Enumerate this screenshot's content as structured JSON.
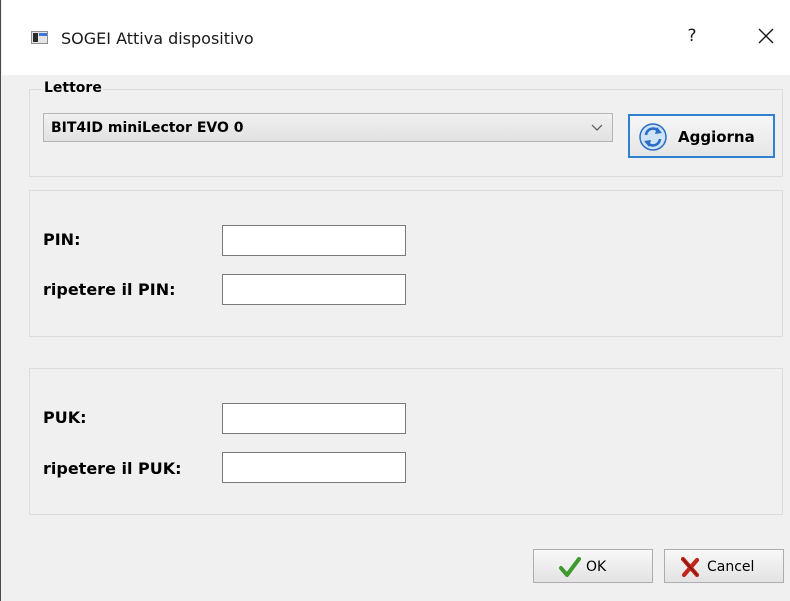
{
  "window": {
    "title": "SOGEI Attiva dispositivo",
    "help_label": "?",
    "app_icon": "window-app-icon",
    "close_icon": "close-icon"
  },
  "reader_group": {
    "legend": "Lettore",
    "selected_reader": "BIT4ID miniLector EVO 0",
    "dropdown_icon": "chevron-down-icon",
    "refresh_button": {
      "label": "Aggiorna",
      "icon": "refresh-icon"
    }
  },
  "pin_group": {
    "pin_label": "PIN:",
    "pin_value": "",
    "repeat_pin_label": "ripetere il PIN:",
    "repeat_pin_value": ""
  },
  "puk_group": {
    "puk_label": "PUK:",
    "puk_value": "",
    "repeat_puk_label": "ripetere il PUK:",
    "repeat_puk_value": ""
  },
  "buttons": {
    "ok_label": "OK",
    "ok_icon": "checkmark-icon",
    "cancel_label": "Cancel",
    "cancel_icon": "red-x-icon"
  },
  "colors": {
    "focus_border": "#2f80d0",
    "ok_green": "#3f9a2e",
    "cancel_red": "#c0261c",
    "refresh_blue": "#2a6fc4"
  }
}
